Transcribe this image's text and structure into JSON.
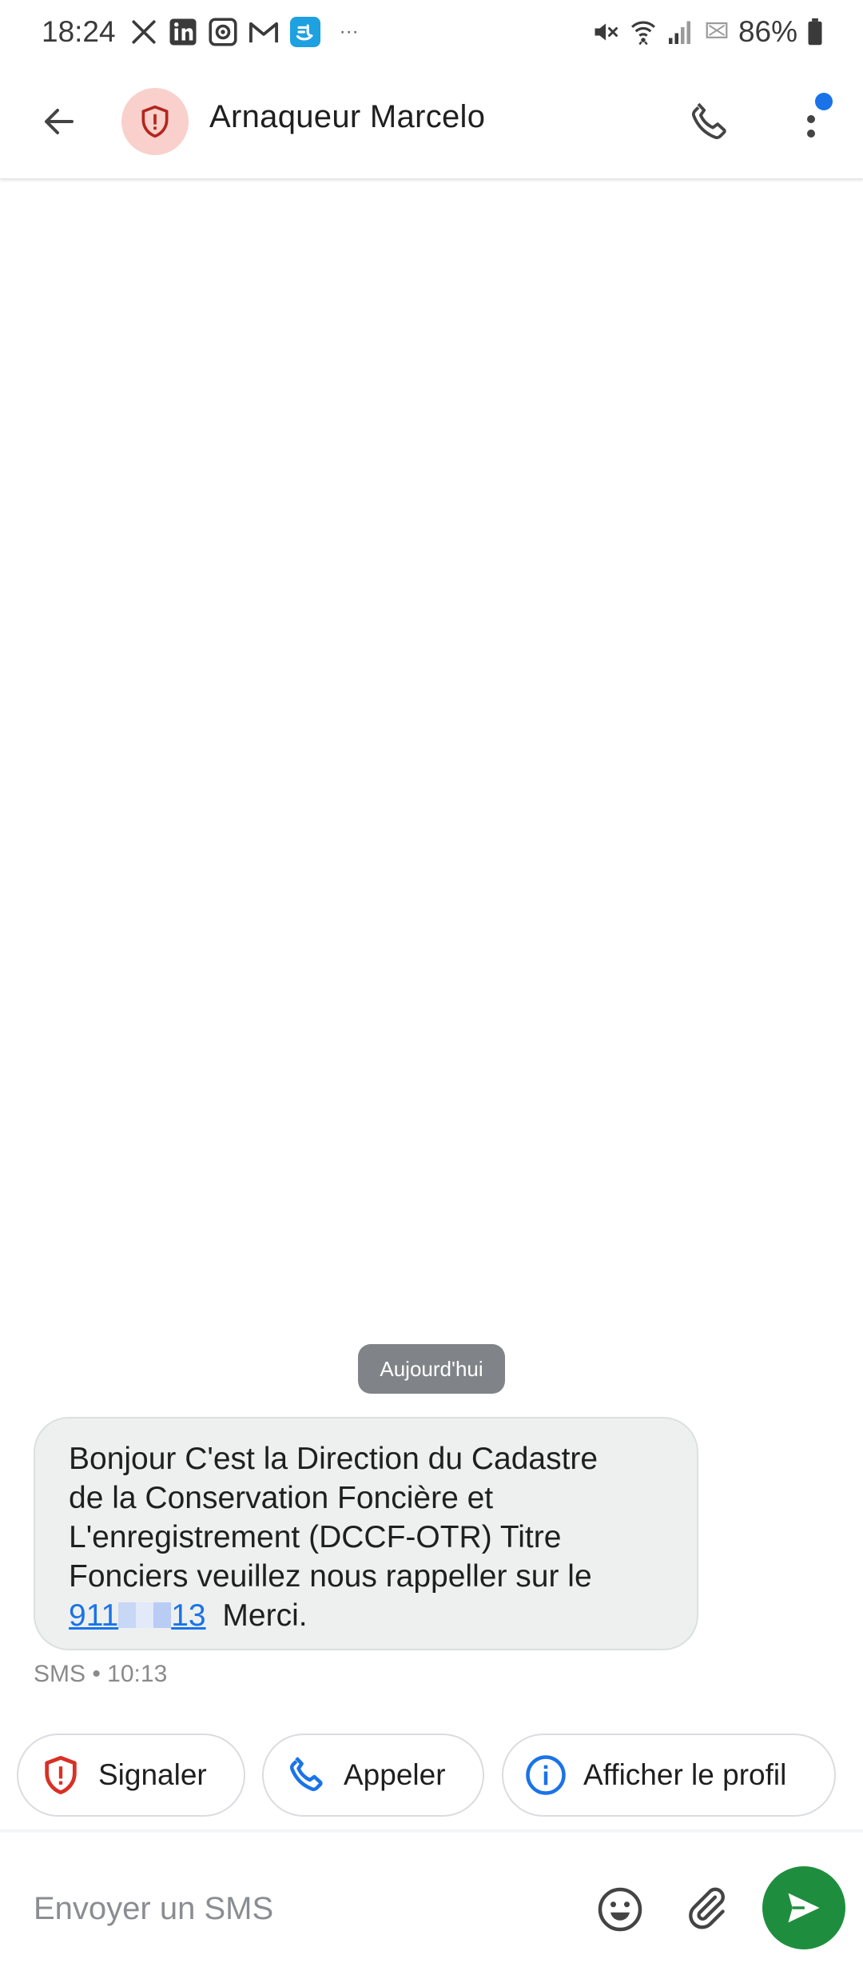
{
  "status_bar": {
    "time": "18:24",
    "app_icons": [
      "x-icon",
      "linkedin-icon",
      "grid-app-icon",
      "gmail-icon",
      "blue-app-icon",
      "more-notifications-icon"
    ],
    "overflow": "···",
    "battery": "86%",
    "right_icons": [
      "muted-icon",
      "wifi-icon",
      "signal-icon",
      "no-sim-icon",
      "battery-icon"
    ]
  },
  "header": {
    "contact_name": "Arnaqueur Marcelo",
    "avatar_icon": "shield-warning-icon",
    "avatar_color": "#f9d0cb",
    "accent": "#1a73e8"
  },
  "conversation": {
    "date_label": "Aujourd'hui",
    "message": {
      "lines": [
        "Bonjour C'est la Direction du Cadastre",
        "de la Conservation Foncière et",
        "L'enregistrement (DCCF-OTR) Titre",
        "Fonciers veuillez nous rappeller sur le"
      ],
      "phone_prefix": "911",
      "phone_suffix": "13",
      "closing": " Merci.",
      "meta": "SMS • 10:13"
    }
  },
  "actions": {
    "report_label": "Signaler",
    "call_label": "Appeler",
    "profile_label": "Afficher le profil"
  },
  "composer": {
    "placeholder": "Envoyer un SMS",
    "send_color": "#1e8e3e"
  }
}
